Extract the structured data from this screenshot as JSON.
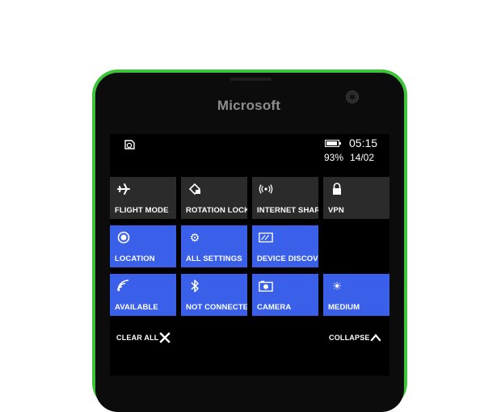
{
  "device": {
    "brand": "Microsoft"
  },
  "status_bar": {
    "time": "05:15",
    "battery_percent": "93%",
    "date": "14/02",
    "notification_icon": "notification-icon",
    "battery_icon": "battery-icon"
  },
  "quick_actions": [
    {
      "label": "FLIGHT MODE",
      "icon": "airplane-icon",
      "active": false
    },
    {
      "label": "ROTATION LOCK",
      "icon": "rotation-lock-icon",
      "active": false
    },
    {
      "label": "INTERNET SHARING",
      "icon": "internet-sharing-icon",
      "active": false
    },
    {
      "label": "VPN",
      "icon": "lock-icon",
      "active": false
    },
    {
      "label": "LOCATION",
      "icon": "location-icon",
      "active": true
    },
    {
      "label": "ALL SETTINGS",
      "icon": "gear-icon",
      "active": true
    },
    {
      "label": "DEVICE DISCOVERY",
      "icon": "device-discovery-icon",
      "active": true
    },
    {
      "label": "AVAILABLE",
      "icon": "wifi-icon",
      "active": true
    },
    {
      "label": "NOT CONNECTED",
      "icon": "bluetooth-icon",
      "active": true
    },
    {
      "label": "CAMERA",
      "icon": "camera-icon",
      "active": true
    },
    {
      "label": "MEDIUM",
      "icon": "brightness-icon",
      "active": true
    }
  ],
  "bottom_bar": {
    "clear_all": "CLEAR ALL",
    "collapse": "COLLAPSE"
  },
  "colors": {
    "phone_frame": "#3ec43a",
    "tile_active": "#3a5fe8",
    "tile_inactive": "#2b2b2b"
  }
}
